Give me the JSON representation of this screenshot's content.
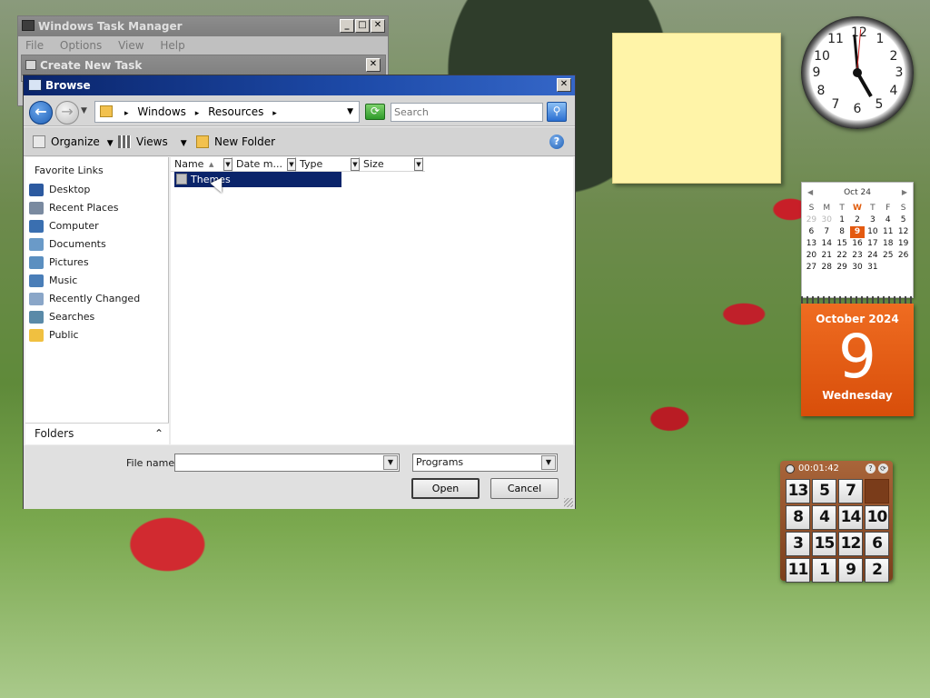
{
  "task_manager": {
    "title": "Windows Task Manager",
    "menu": [
      "File",
      "Options",
      "View",
      "Help"
    ]
  },
  "create_task": {
    "title": "Create New Task"
  },
  "browse": {
    "title": "Browse",
    "breadcrumbs": [
      "Windows",
      "Resources"
    ],
    "search_placeholder": "Search",
    "commands": {
      "organize": "Organize",
      "views": "Views",
      "new_folder": "New Folder"
    },
    "favorites_heading": "Favorite Links",
    "favorites": [
      {
        "label": "Desktop",
        "icon": "desktop-icon",
        "color": "#2c5aa0"
      },
      {
        "label": "Recent Places",
        "icon": "recent-places-icon",
        "color": "#7a8aa0"
      },
      {
        "label": "Computer",
        "icon": "computer-icon",
        "color": "#3a6fb0"
      },
      {
        "label": "Documents",
        "icon": "documents-icon",
        "color": "#6a9ac8"
      },
      {
        "label": "Pictures",
        "icon": "pictures-icon",
        "color": "#5b8fc0"
      },
      {
        "label": "Music",
        "icon": "music-icon",
        "color": "#4a7eb8"
      },
      {
        "label": "Recently Changed",
        "icon": "recently-changed-icon",
        "color": "#8aa6c8"
      },
      {
        "label": "Searches",
        "icon": "searches-icon",
        "color": "#5a8aa8"
      },
      {
        "label": "Public",
        "icon": "public-folder-icon",
        "color": "#f0c040"
      }
    ],
    "folders_label": "Folders",
    "columns": [
      "Name",
      "Date m...",
      "Type",
      "Size"
    ],
    "files": [
      {
        "name": "Themes",
        "selected": true
      }
    ],
    "file_name_label": "File name:",
    "file_name_value": "",
    "file_type_value": "Programs",
    "open_label": "Open",
    "cancel_label": "Cancel"
  },
  "calendar": {
    "month_header": "Oct 24",
    "weekdays": [
      "S",
      "M",
      "T",
      "W",
      "T",
      "F",
      "S"
    ],
    "days": [
      [
        "29",
        "30",
        "1",
        "2",
        "3",
        "4",
        "5"
      ],
      [
        "6",
        "7",
        "8",
        "9",
        "10",
        "11",
        "12"
      ],
      [
        "13",
        "14",
        "15",
        "16",
        "17",
        "18",
        "19"
      ],
      [
        "20",
        "21",
        "22",
        "23",
        "24",
        "25",
        "26"
      ],
      [
        "27",
        "28",
        "29",
        "30",
        "31",
        "",
        ""
      ]
    ],
    "selected_day": "9",
    "month_year": "October 2024",
    "day": "9",
    "weekday": "Wednesday"
  },
  "clock": {
    "numbers": [
      "12",
      "1",
      "2",
      "3",
      "4",
      "5",
      "6",
      "7",
      "8",
      "9",
      "10",
      "11"
    ]
  },
  "puzzle": {
    "timer": "00:01:42",
    "tiles": [
      "13",
      "5",
      "7",
      "",
      "8",
      "4",
      "14",
      "10",
      "3",
      "15",
      "12",
      "6",
      "11",
      "1",
      "9",
      "2"
    ]
  },
  "colors": {
    "accent_title": "#0a246a",
    "calendar_orange": "#e45a10",
    "note_yellow": "#fff4a8"
  }
}
